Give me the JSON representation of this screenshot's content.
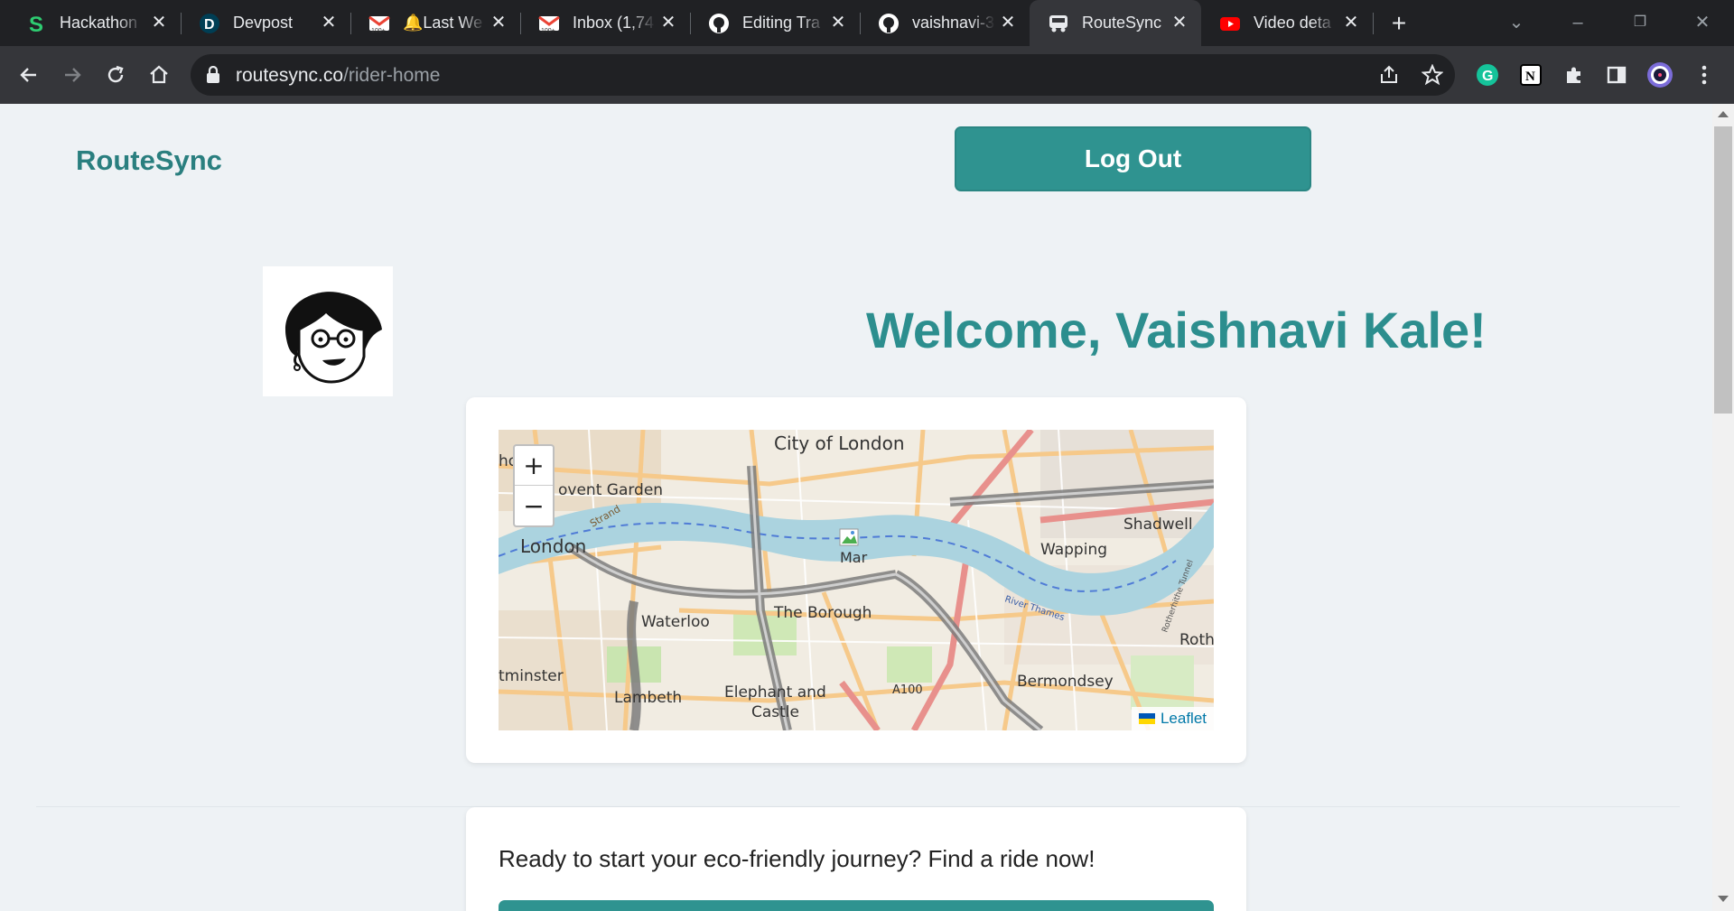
{
  "browser": {
    "tabs": [
      {
        "title": "Hackathon",
        "icon": "s-logo-icon",
        "color": "#2ecc71"
      },
      {
        "title": "Devpost",
        "icon": "devpost-icon",
        "color": "#003e54"
      },
      {
        "title": "🔔Last We",
        "icon": "gmail-icon",
        "color": "#ea4335"
      },
      {
        "title": "Inbox (1,74",
        "icon": "gmail-icon",
        "color": "#ea4335"
      },
      {
        "title": "Editing Tra",
        "icon": "github-icon",
        "color": "#ffffff"
      },
      {
        "title": "vaishnavi-3",
        "icon": "github-icon",
        "color": "#ffffff"
      },
      {
        "title": "RouteSync",
        "icon": "car-icon",
        "color": "#e8eaed"
      },
      {
        "title": "Video deta",
        "icon": "youtube-icon",
        "color": "#ff0000"
      }
    ],
    "active_tab": "RouteSync",
    "url_host": "routesync.co",
    "url_path": "/rider-home"
  },
  "page": {
    "brand": "RouteSync",
    "logout_label": "Log Out",
    "welcome": "Welcome, Vaishnavi Kale!",
    "ride_prompt": "Ready to start your eco-friendly journey? Find a ride now!",
    "accent_color": "#2f9390"
  },
  "map": {
    "zoom_in": "+",
    "zoom_out": "−",
    "attribution": "Leaflet",
    "marker_alt": "Mar",
    "labels": {
      "city": "City of London",
      "covent": "ovent Garden",
      "ho": "ho",
      "london": "London",
      "shadwell": "Shadwell",
      "wapping": "Wapping",
      "borough": "The Borough",
      "waterloo": "Waterloo",
      "rotherhithe": "Roth",
      "minster": "tminster",
      "lambeth": "Lambeth",
      "elephant1": "Elephant and",
      "elephant2": "Castle",
      "a100": "A100",
      "bermondsey": "Bermondsey",
      "strand": "Strand",
      "river": "River Thames",
      "tunnel": "Rotherhithe Tunnel"
    }
  }
}
